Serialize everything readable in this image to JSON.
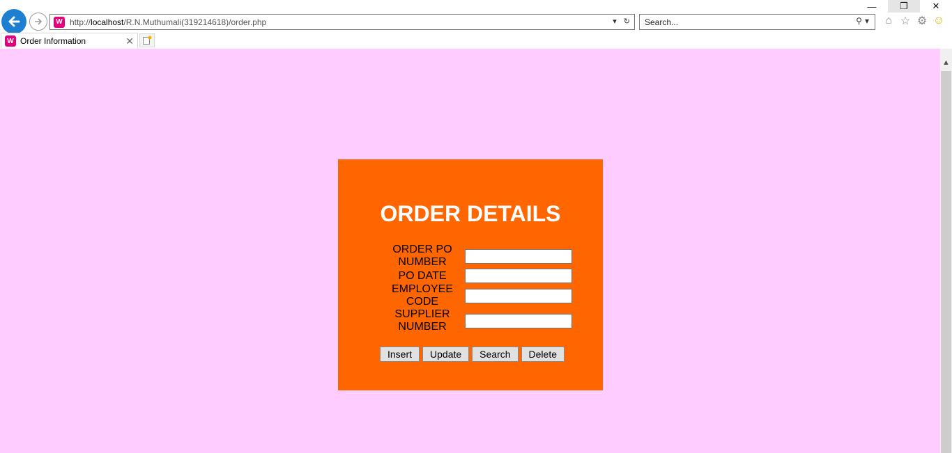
{
  "browser": {
    "url_prefix": "http://",
    "url_host": "localhost",
    "url_path": "/R.N.Muthumali(319214618)/order.php",
    "search_placeholder": "Search...",
    "tab_title": "Order Information",
    "favicon_letter": "W"
  },
  "page": {
    "background_color": "#ffccff",
    "panel_color": "#ff6600",
    "title": "ORDER DETAILS",
    "fields": [
      {
        "label": "ORDER PO NUMBER",
        "value": ""
      },
      {
        "label": "PO DATE",
        "value": ""
      },
      {
        "label": "EMPLOYEE CODE",
        "value": ""
      },
      {
        "label": "SUPPLIER NUMBER",
        "value": ""
      }
    ],
    "buttons": [
      "Insert",
      "Update",
      "Search",
      "Delete"
    ]
  }
}
